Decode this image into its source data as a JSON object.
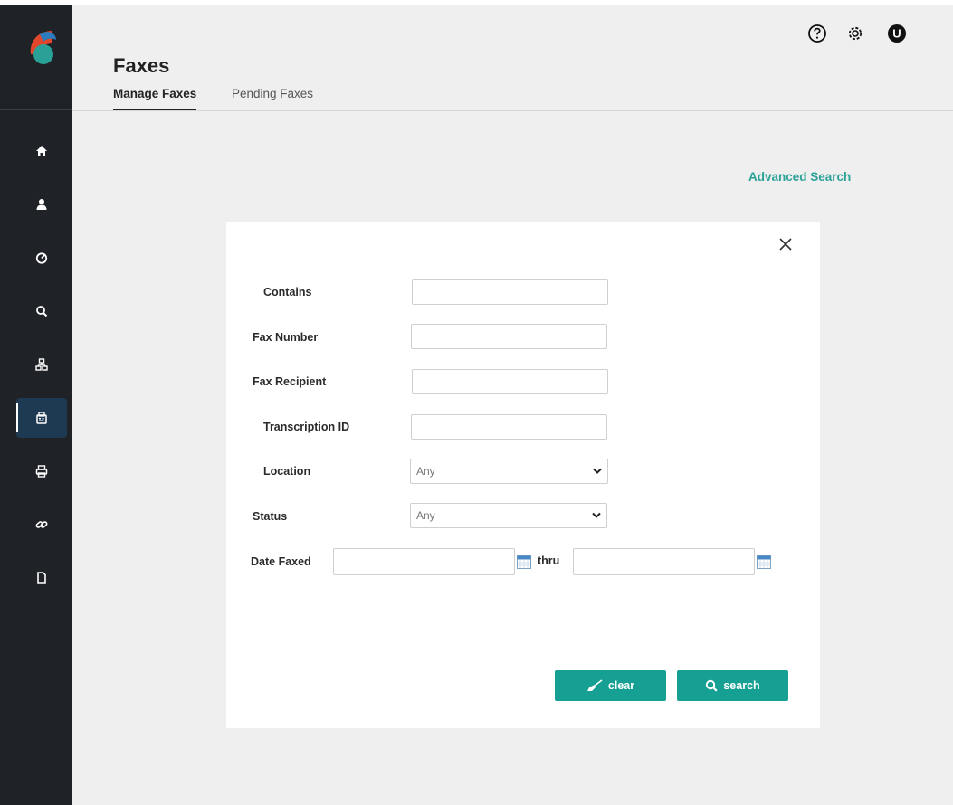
{
  "page": {
    "title": "Faxes"
  },
  "tabs": [
    {
      "label": "Manage Faxes",
      "active": true
    },
    {
      "label": "Pending Faxes",
      "active": false
    }
  ],
  "header_icons": [
    "help-icon",
    "settings-icon",
    "user-avatar"
  ],
  "user": {
    "initial": "U"
  },
  "sidebar": {
    "items": [
      {
        "icon": "home-icon"
      },
      {
        "icon": "user-icon"
      },
      {
        "icon": "gauge-icon"
      },
      {
        "icon": "search-icon"
      },
      {
        "icon": "network-icon"
      },
      {
        "icon": "fax-icon",
        "active": true
      },
      {
        "icon": "printer-icon"
      },
      {
        "icon": "link-icon"
      },
      {
        "icon": "document-icon"
      }
    ]
  },
  "advanced_search": {
    "label": "Advanced Search"
  },
  "form": {
    "contains": {
      "label": "Contains",
      "value": ""
    },
    "fax_number": {
      "label": "Fax Number",
      "value": ""
    },
    "fax_recipient": {
      "label": "Fax Recipient",
      "value": ""
    },
    "transcription_id": {
      "label": "Transcription ID",
      "value": ""
    },
    "location": {
      "label": "Location",
      "selected": "Any"
    },
    "status": {
      "label": "Status",
      "selected": "Any"
    },
    "date_faxed": {
      "label": "Date Faxed",
      "from": "",
      "thru_label": "thru",
      "to": ""
    }
  },
  "buttons": {
    "clear": "clear",
    "search": "search"
  },
  "colors": {
    "sidebar_bg": "#1f2226",
    "accent": "#169f93",
    "link": "#2aa197",
    "active_nav": "#1e3a52",
    "page_bg": "#efefef"
  }
}
